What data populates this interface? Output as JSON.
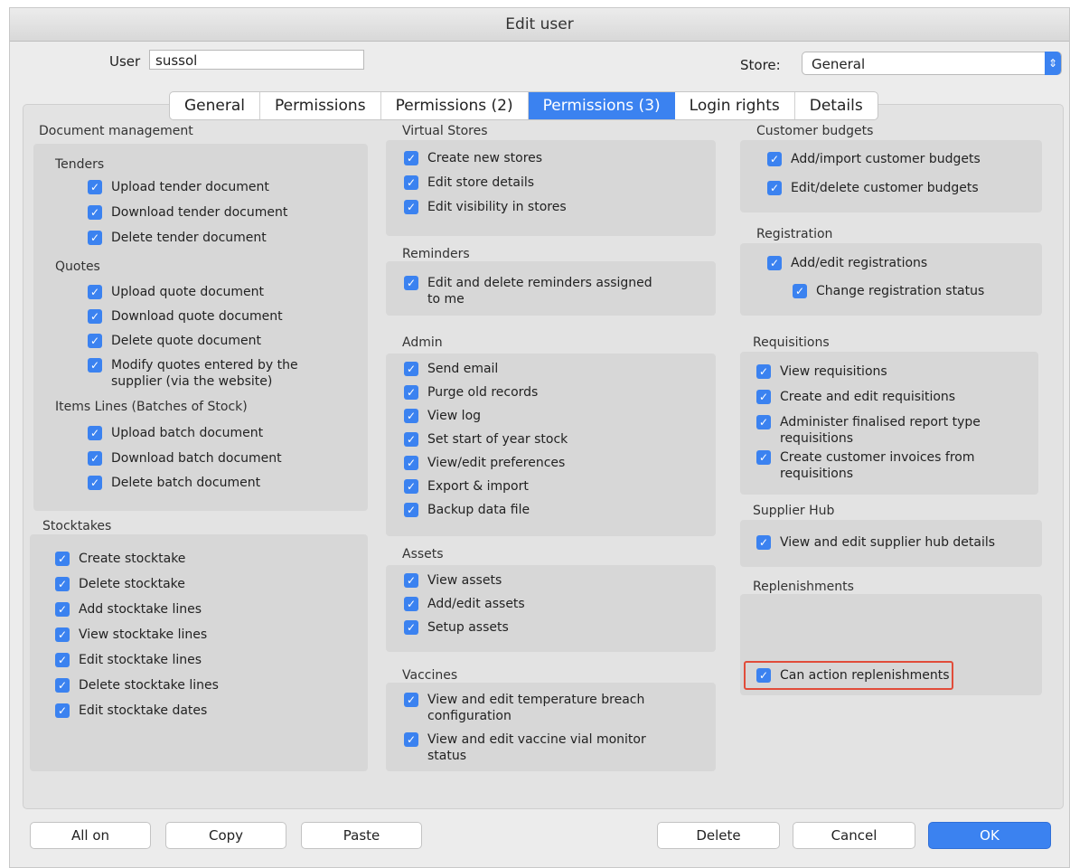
{
  "window": {
    "title": "Edit user"
  },
  "user": {
    "label": "User",
    "value": "sussol"
  },
  "store": {
    "label": "Store:",
    "value": "General"
  },
  "tabs": [
    "General",
    "Permissions",
    "Permissions (2)",
    "Permissions (3)",
    "Login rights",
    "Details"
  ],
  "active_tab": "Permissions (3)",
  "document_management": {
    "title": "Document management",
    "tenders": {
      "title": "Tenders",
      "items": [
        "Upload tender document",
        "Download tender document",
        "Delete tender document"
      ]
    },
    "quotes": {
      "title": "Quotes",
      "items": [
        "Upload quote document",
        "Download quote document",
        "Delete quote document",
        "Modify quotes entered by the supplier (via the website)"
      ]
    },
    "items_lines": {
      "title": "Items Lines (Batches of Stock)",
      "items": [
        "Upload batch document",
        "Download batch document",
        "Delete batch document"
      ]
    }
  },
  "stocktakes": {
    "title": "Stocktakes",
    "items": [
      "Create stocktake",
      "Delete stocktake",
      "Add stocktake lines",
      "View stocktake lines",
      "Edit stocktake lines",
      "Delete stocktake lines",
      "Edit stocktake dates"
    ]
  },
  "virtual_stores": {
    "title": "Virtual Stores",
    "items": [
      "Create new stores",
      "Edit store details",
      "Edit visibility in stores"
    ]
  },
  "reminders": {
    "title": "Reminders",
    "items": [
      "Edit and delete reminders assigned to me"
    ]
  },
  "admin": {
    "title": "Admin",
    "items": [
      "Send email",
      "Purge old records",
      "View log",
      "Set start of year stock",
      "View/edit preferences",
      "Export & import",
      "Backup data file"
    ]
  },
  "assets": {
    "title": "Assets",
    "items": [
      "View assets",
      "Add/edit assets",
      "Setup assets"
    ]
  },
  "vaccines": {
    "title": "Vaccines",
    "items": [
      "View and edit temperature breach configuration",
      "View and edit vaccine vial monitor status"
    ]
  },
  "customer_budgets": {
    "title": "Customer budgets",
    "items": [
      "Add/import customer budgets",
      "Edit/delete customer budgets"
    ]
  },
  "registration": {
    "title": "Registration",
    "items": [
      "Add/edit registrations",
      "Change registration status"
    ]
  },
  "requisitions": {
    "title": "Requisitions",
    "items": [
      "View requisitions",
      "Create and edit requisitions",
      "Administer finalised report type requisitions",
      "Create customer invoices from requisitions"
    ]
  },
  "supplier_hub": {
    "title": "Supplier Hub",
    "items": [
      "View and edit supplier hub details"
    ]
  },
  "replenishments": {
    "title": "Replenishments",
    "items": [
      "Can action replenishments"
    ]
  },
  "buttons": {
    "all_on": "All on",
    "copy": "Copy",
    "paste": "Paste",
    "delete": "Delete",
    "cancel": "Cancel",
    "ok": "OK"
  },
  "icons": {
    "checkbox": "check-icon",
    "select_arrow": "stepper-arrows-icon"
  },
  "colors": {
    "accent": "#3b82f0",
    "highlight": "#e14c3a"
  }
}
